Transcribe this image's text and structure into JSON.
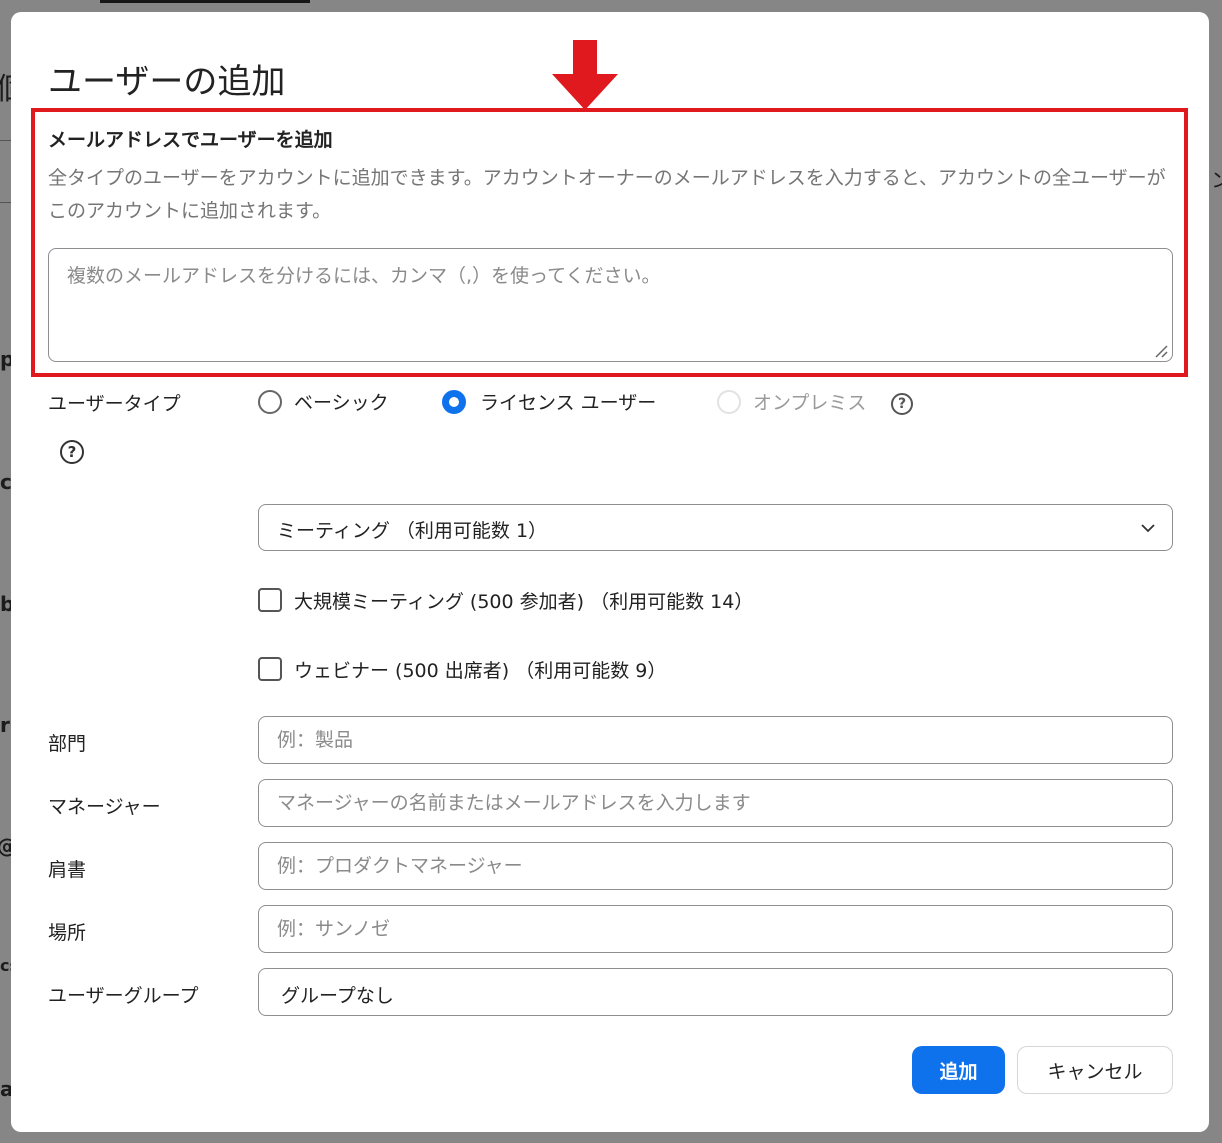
{
  "background": {
    "fragments": [
      "個",
      "p",
      "c",
      "b",
      "r",
      "@",
      "cs",
      "a",
      "ン"
    ]
  },
  "dialog": {
    "title": "ユーザーの追加",
    "email_section": {
      "title": "メールアドレスでユーザーを追加",
      "description": "全タイプのユーザーをアカウントに追加できます。アカウントオーナーのメールアドレスを入力すると、アカウントの全ユーザーがこのアカウントに追加されます。",
      "email_placeholder": "複数のメールアドレスを分けるには、カンマ（,）を使ってください。",
      "email_value": ""
    },
    "user_type": {
      "label": "ユーザータイプ",
      "options": [
        {
          "label": "ベーシック",
          "checked": false,
          "disabled": false
        },
        {
          "label": "ライセンス ユーザー",
          "checked": true,
          "disabled": false
        },
        {
          "label": "オンプレミス",
          "checked": false,
          "disabled": true
        }
      ],
      "license_select": "ミーティング （利用可能数 1）",
      "addons": [
        {
          "label": "大規模ミーティング (500 参加者) （利用可能数 14）",
          "checked": false
        },
        {
          "label": "ウェビナー (500 出席者) （利用可能数 9）",
          "checked": false
        }
      ]
    },
    "fields": {
      "department": {
        "label": "部門",
        "placeholder": "例：製品",
        "value": ""
      },
      "manager": {
        "label": "マネージャー",
        "placeholder": "マネージャーの名前またはメールアドレスを入力します",
        "value": ""
      },
      "job_title": {
        "label": "肩書",
        "placeholder": "例：プロダクトマネージャー",
        "value": ""
      },
      "location": {
        "label": "場所",
        "placeholder": "例：サンノゼ",
        "value": ""
      },
      "user_group": {
        "label": "ユーザーグループ",
        "value": "グループなし"
      }
    },
    "buttons": {
      "add": "追加",
      "cancel": "キャンセル"
    },
    "help_glyph": "?"
  },
  "colors": {
    "primary": "#0e72ed",
    "highlight": "#e0191f",
    "muted_text": "#757575"
  }
}
